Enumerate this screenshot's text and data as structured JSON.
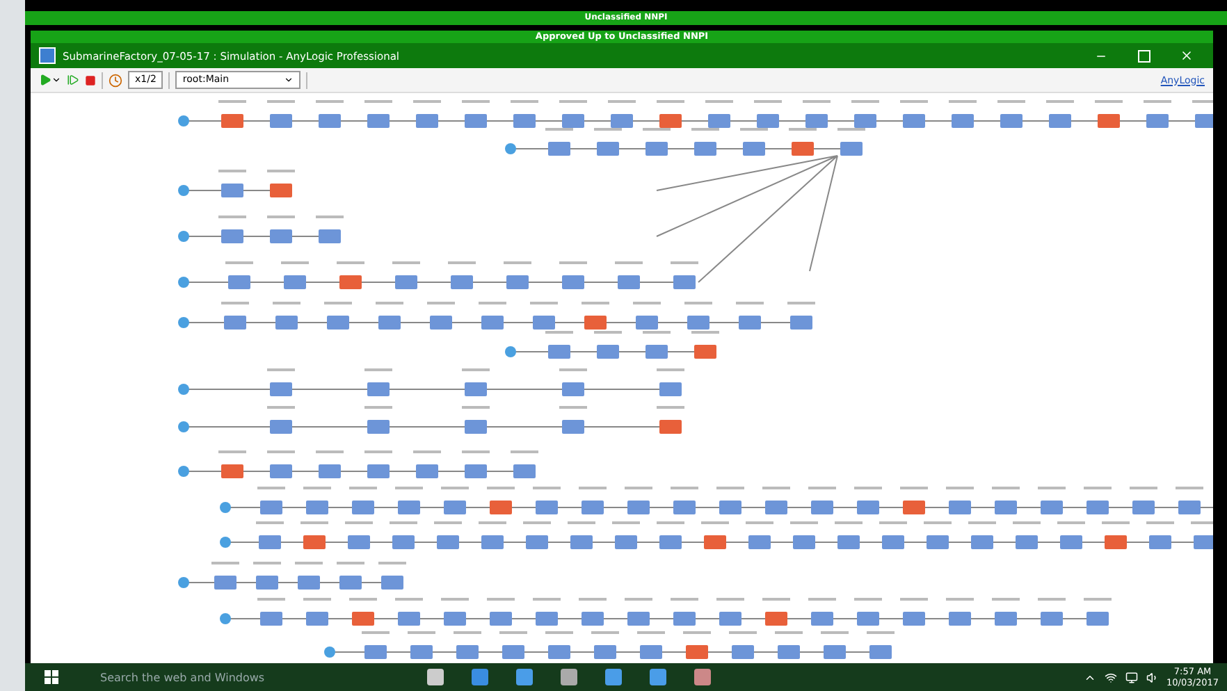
{
  "banner_outer": "Unclassified NNPI",
  "banner_inner": "Approved Up to Unclassified NNPI",
  "window": {
    "title": "SubmarineFactory_07-05-17 : Simulation - AnyLogic Professional"
  },
  "toolbar": {
    "speed": "x1/2",
    "view": "root:Main",
    "brand": "AnyLogic"
  },
  "taskbar": {
    "search_placeholder": "Search the web and Windows",
    "time": "7:57 AM",
    "date": "10/03/2017"
  }
}
